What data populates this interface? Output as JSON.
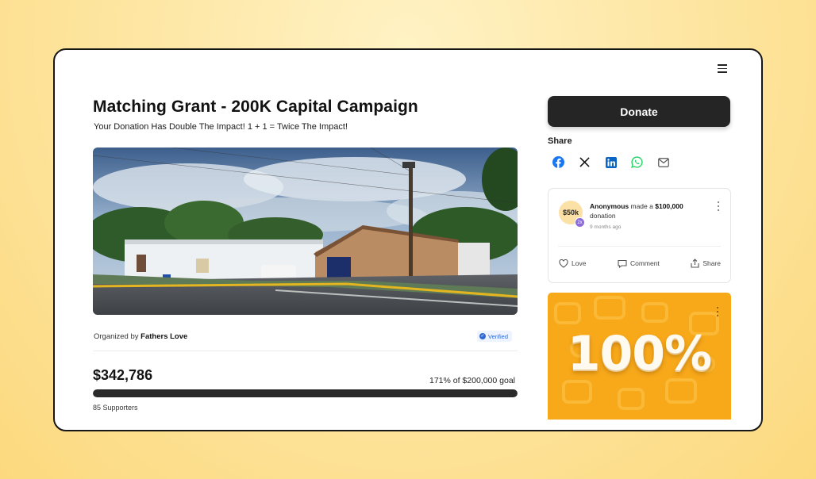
{
  "campaign": {
    "title": "Matching Grant - 200K Capital Campaign",
    "subtitle": "Your Donation Has Double The Impact! 1 + 1 = Twice The Impact!",
    "organized_by_prefix": "Organized by",
    "organizer": "Fathers Love",
    "verified_label": "Verified",
    "raised": "$342,786",
    "goal_text": "171% of $200,000 goal",
    "progress_fraction": 1.0,
    "supporters": "85 Supporters"
  },
  "sidebar": {
    "donate_label": "Donate",
    "share_label": "Share",
    "share_icons": [
      "facebook-icon",
      "x-icon",
      "linkedin-icon",
      "whatsapp-icon",
      "mail-icon"
    ],
    "activity": {
      "badge": "$50k",
      "multiplier": "2x",
      "donor": "Anonymous",
      "made_a": "made a",
      "amount": "$100,000",
      "suffix": "donation",
      "time": "9 months ago",
      "actions": [
        "Love",
        "Comment",
        "Share"
      ]
    },
    "promo_text": "100%"
  },
  "colors": {
    "background": "#fde39a",
    "accent_dark": "#252525",
    "verified_blue": "#2e69d6",
    "promo_orange": "#f8a91a",
    "facebook": "#1877f2",
    "linkedin": "#0a66c2",
    "whatsapp": "#25d366"
  }
}
